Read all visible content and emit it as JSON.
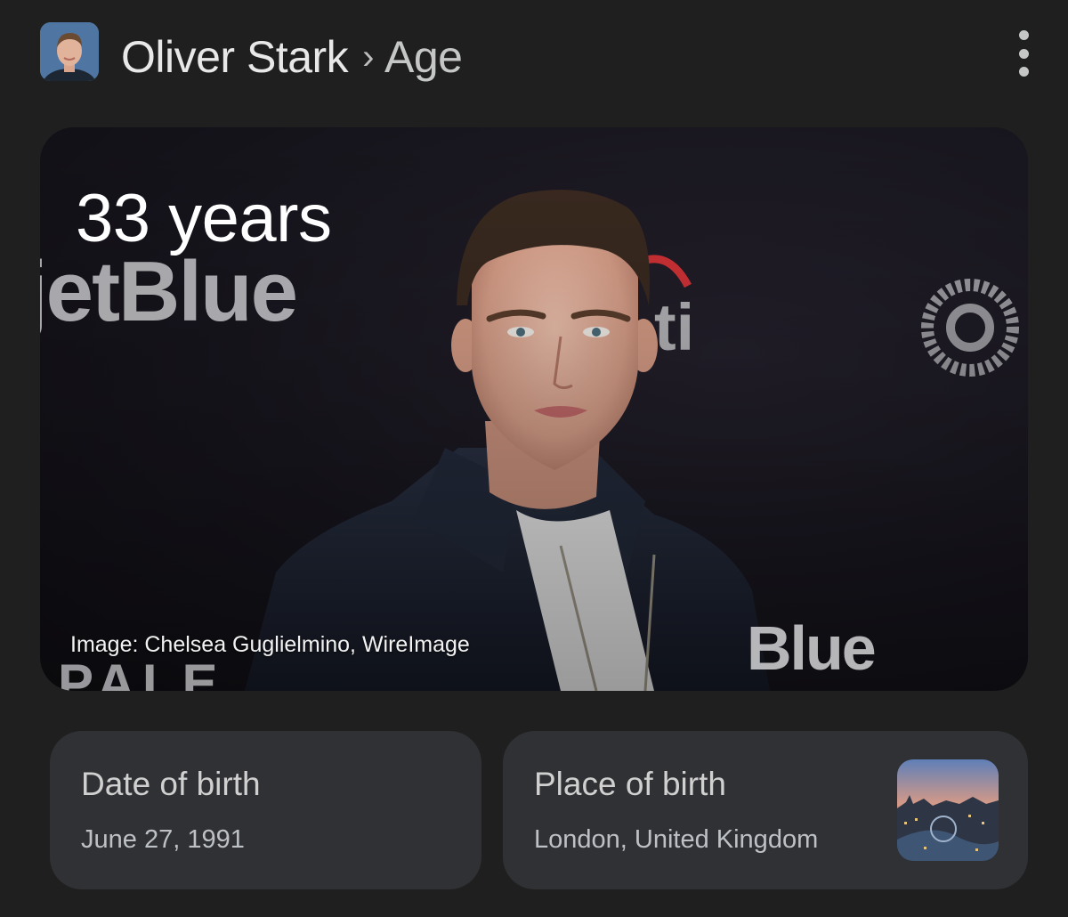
{
  "header": {
    "entity": "Oliver Stark",
    "separator": "›",
    "attribute": "Age",
    "menu_icon": "more-vert-icon"
  },
  "hero": {
    "answer": "33 years",
    "credit": "Image: Chelsea Guglielmino, WireImage",
    "backdrop_text_top": "jetBlue",
    "backdrop_text_bottom": "Blue",
    "backdrop_text_left": "PALE"
  },
  "cards": [
    {
      "label": "Date of birth",
      "value": "June 27, 1991"
    },
    {
      "label": "Place of birth",
      "value": "London, United Kingdom"
    }
  ],
  "colors": {
    "background": "#1f1f1f",
    "card": "#303134",
    "text_primary": "#e3e3e3",
    "text_secondary": "#bdc1c6"
  }
}
